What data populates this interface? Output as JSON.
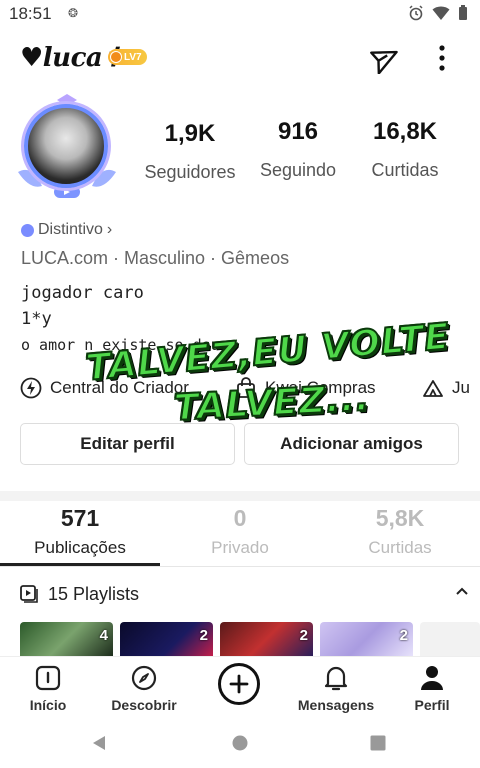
{
  "status_bar": {
    "time": "18:51",
    "notif": "❂"
  },
  "header": {
    "username": "♥luca✝",
    "level_badge": "LV7"
  },
  "stats": [
    {
      "value": "1,9K",
      "label": "Seguidores"
    },
    {
      "value": "916",
      "label": "Seguindo"
    },
    {
      "value": "16,8K",
      "label": "Curtidas"
    }
  ],
  "profile": {
    "distintivo": "Distintivo",
    "distintivo_chevron": "›",
    "meta": "LUCA.com · Masculino · Gêmeos",
    "bio": [
      "jogador caro",
      "1*y",
      "o amor n existe,so deus"
    ]
  },
  "overlay": {
    "line1": "TALVEZ,EU VOLTE",
    "line2": "TALVEZ..."
  },
  "links": [
    {
      "label": "Central do Criador",
      "icon": "lightning-icon"
    },
    {
      "label": "Kwai Compras",
      "icon": "shopping-bag-icon"
    },
    {
      "label": "Ju",
      "icon": "tent-icon"
    }
  ],
  "buttons": {
    "edit": "Editar perfil",
    "add_friends": "Adicionar amigos"
  },
  "tabs": [
    {
      "value": "571",
      "label": "Publicações"
    },
    {
      "value": "0",
      "label": "Privado"
    },
    {
      "value": "5,8K",
      "label": "Curtidas"
    }
  ],
  "playlists": {
    "label": "15 Playlists"
  },
  "thumbnails": [
    {
      "count": "4"
    },
    {
      "count": "2"
    },
    {
      "count": "2"
    },
    {
      "count": "2"
    }
  ],
  "nav": [
    {
      "label": "Início",
      "icon": "home-icon"
    },
    {
      "label": "Descobrir",
      "icon": "compass-icon"
    },
    {
      "label": "Mensagens",
      "icon": "bell-icon"
    },
    {
      "label": "Perfil",
      "icon": "person-icon"
    }
  ],
  "colors": {
    "accent_green": "#4fd84a",
    "badge_gold": "#f9b233",
    "avatar_ring": "#6b8cff"
  }
}
